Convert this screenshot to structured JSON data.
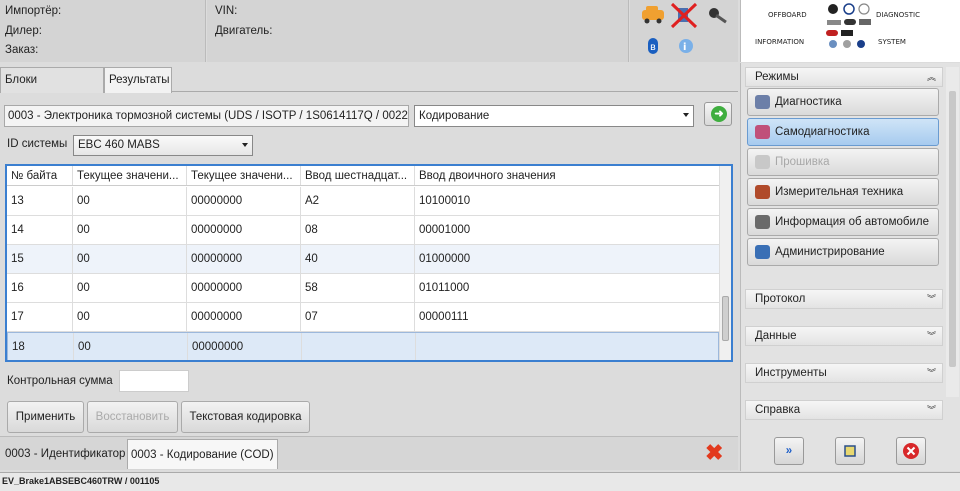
{
  "header": {
    "importer_label": "Импортёр:",
    "dealer_label": "Дилер:",
    "order_label": "Заказ:",
    "vin_label": "VIN:",
    "engine_label": "Двигатель:",
    "logo_words": [
      "OFFBOARD",
      "DIAGNOSTIC",
      "INFORMATION",
      "SYSTEM"
    ]
  },
  "tabs": [
    {
      "label": "Блоки управления"
    },
    {
      "label": "Результаты"
    }
  ],
  "control": {
    "ecu_value": "0003 - Электроника тормозной системы  (UDS / ISOTP / 1S0614117Q / 0022",
    "mode_value": "Кодирование",
    "system_id_label": "ID системы",
    "system_id_value": "EBC 460 MABS"
  },
  "table": {
    "headers": [
      "№ байта",
      "Текущее значени...",
      "Текущее значени...",
      "Ввод шестнадцат...",
      "Ввод двоичного значения"
    ],
    "rows": [
      [
        "13",
        "00",
        "00000000",
        "A2",
        "10100010"
      ],
      [
        "14",
        "00",
        "00000000",
        "08",
        "00001000"
      ],
      [
        "15",
        "00",
        "00000000",
        "40",
        "01000000"
      ],
      [
        "16",
        "00",
        "00000000",
        "58",
        "01011000"
      ],
      [
        "17",
        "00",
        "00000000",
        "07",
        "00000111"
      ],
      [
        "18",
        "00",
        "00000000",
        "",
        ""
      ]
    ]
  },
  "checksum_label": "Контрольная сумма",
  "buttons": {
    "apply": "Применить",
    "restore": "Восстановить",
    "text_coding": "Текстовая кодировка"
  },
  "bottom_tabs": [
    {
      "label": "0003 - Идентификатор"
    },
    {
      "label": "0003 - Кодирование (COD)"
    }
  ],
  "status_text": "EV_Brake1ABSEBC460TRW / 001105",
  "right_panel": {
    "modes_title": "Режимы",
    "modes": [
      {
        "label": "Диагностика",
        "icon": "stethoscope-icon",
        "color": "#6c7fa8"
      },
      {
        "label": "Самодиагностика",
        "icon": "book-icon",
        "color": "#c0507a"
      },
      {
        "label": "Прошивка",
        "icon": "car-icon",
        "color": "#c8c8c8"
      },
      {
        "label": "Измерительная техника",
        "icon": "gauge-icon",
        "color": "#b04a2a"
      },
      {
        "label": "Информация об автомобиле",
        "icon": "car-info-icon",
        "color": "#6a6a6a"
      },
      {
        "label": "Администрирование",
        "icon": "admin-gear-icon",
        "color": "#3a6fb5"
      }
    ],
    "sections": [
      "Протокол",
      "Данные",
      "Инструменты",
      "Справка"
    ]
  },
  "colors": {
    "accent": "#3b7fd0",
    "active_mode": "#a7cbef",
    "close_red": "#e23a1e",
    "go_green": "#3fae3f"
  }
}
